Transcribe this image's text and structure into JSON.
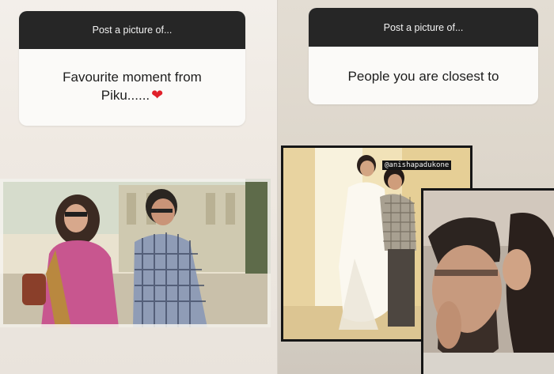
{
  "stories": [
    {
      "question_header": "Post a picture of...",
      "question_text_line1": "Favourite moment from",
      "question_text_line2": "Piku......",
      "heart_icon": "red-heart-emoji"
    },
    {
      "question_header": "Post a picture of...",
      "question_text": "People you are closest to",
      "mention_tag": "@anishapadukone"
    }
  ],
  "colors": {
    "card_header": "#262626",
    "card_body": "#fbfaf8",
    "heart": "#e0202a"
  }
}
